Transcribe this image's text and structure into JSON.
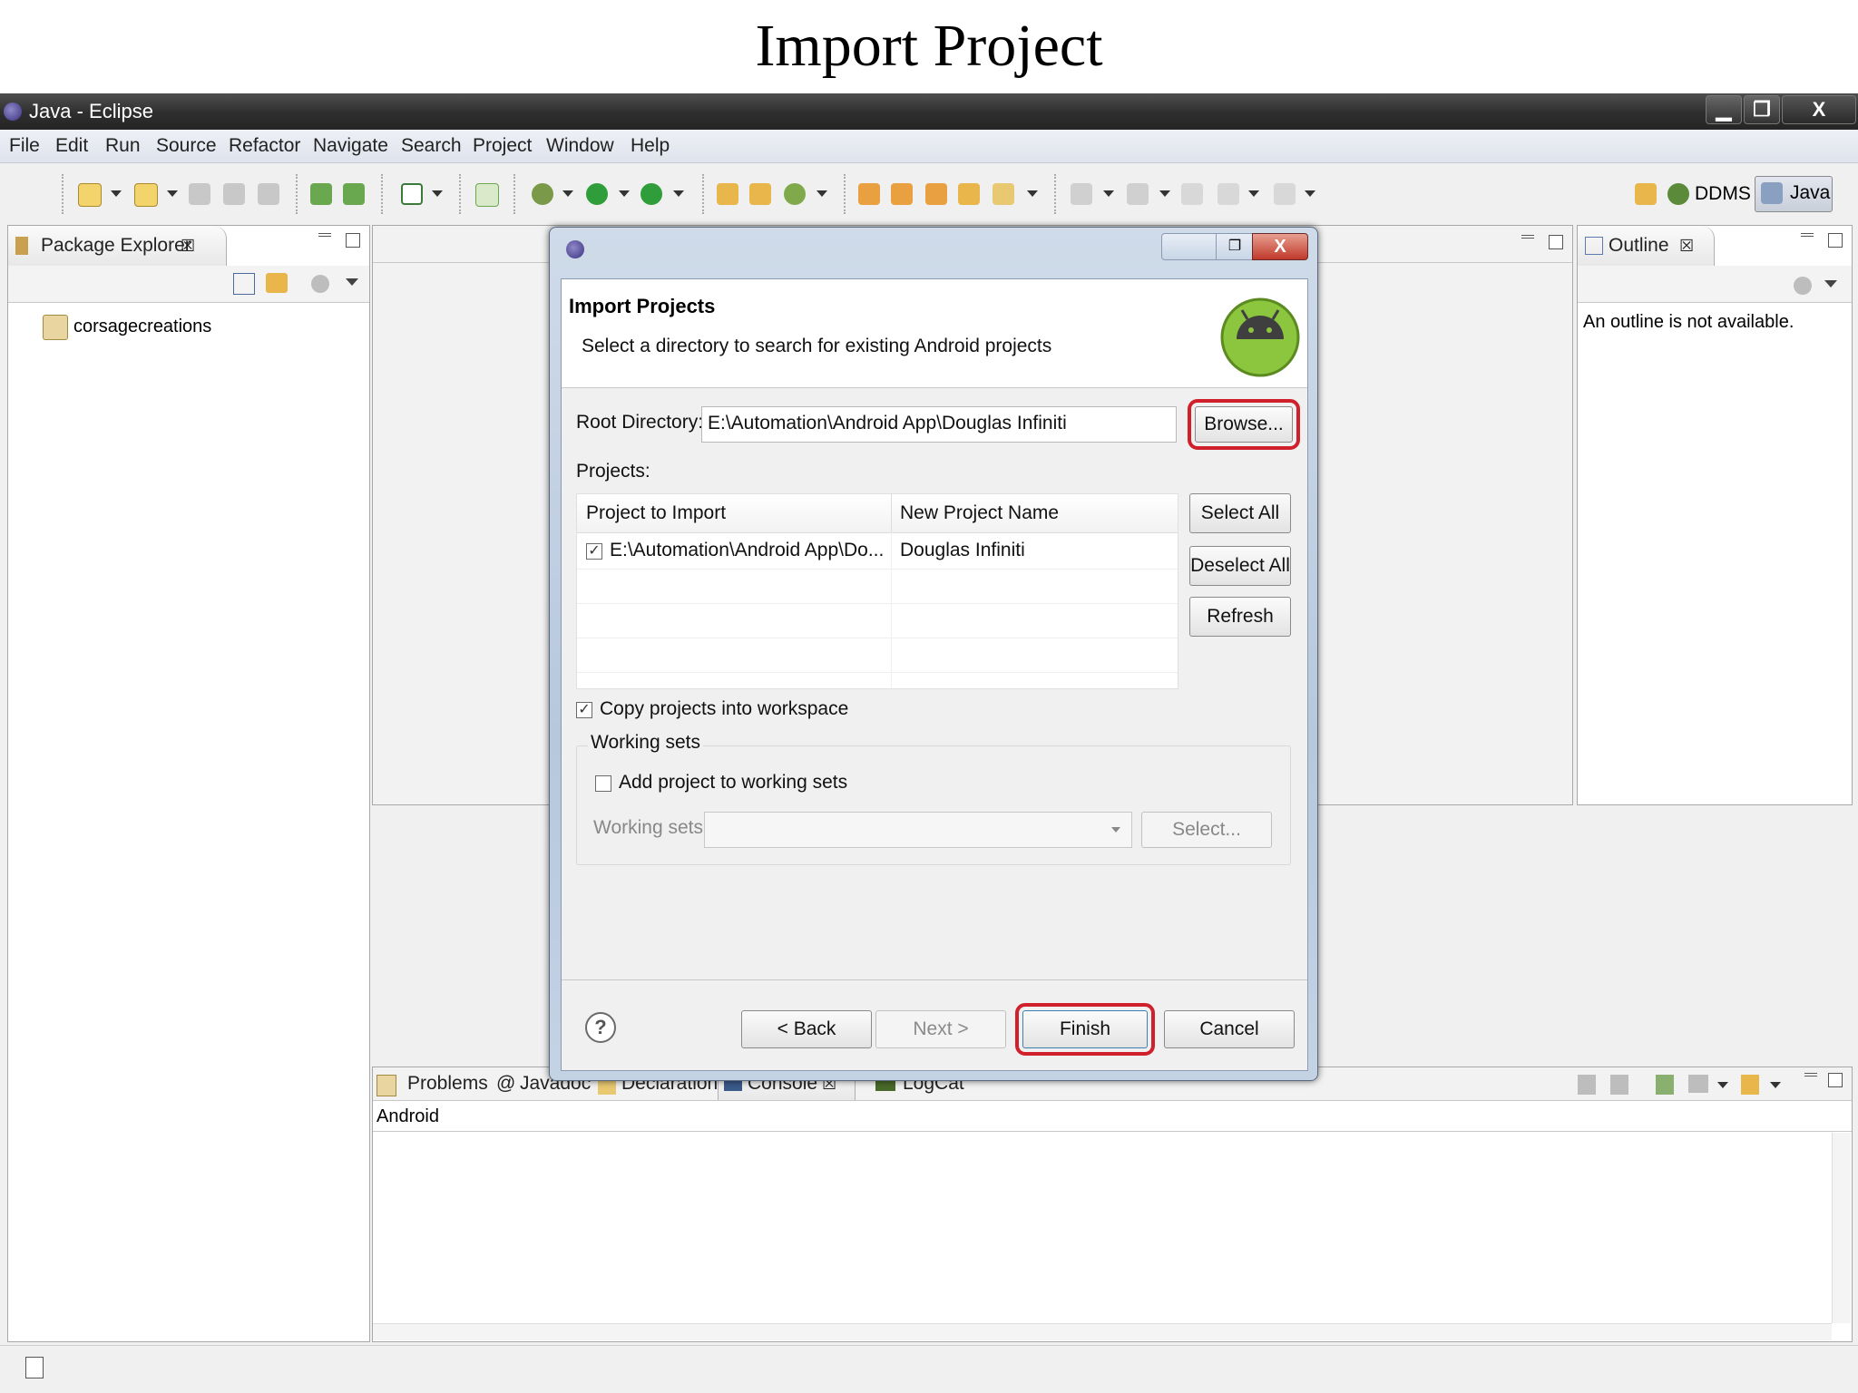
{
  "slide": {
    "title": "Import Project"
  },
  "window": {
    "title": "Java - Eclipse",
    "controls": {
      "minimize": "▁",
      "restore": "❐",
      "close": "X"
    }
  },
  "menu": [
    "File",
    "Edit",
    "Run",
    "Source",
    "Refactor",
    "Navigate",
    "Search",
    "Project",
    "Window",
    "Help"
  ],
  "perspectives": {
    "ddms": "DDMS",
    "java": "Java"
  },
  "package_explorer": {
    "tab_label": "Package Explorer",
    "close_glyph": "☒",
    "items": [
      {
        "label": "corsagecreations",
        "icon": "project-icon"
      }
    ]
  },
  "outline": {
    "tab_label": "Outline",
    "close_glyph": "☒",
    "message": "An outline is not available."
  },
  "bottom_panel": {
    "tabs": [
      "Problems",
      "Javadoc",
      "Declaration",
      "Console",
      "LogCat"
    ],
    "active_tab": "Console",
    "console_label": "Android",
    "at_glyph": "@"
  },
  "dialog": {
    "header_title": "Import Projects",
    "header_subtitle": "Select a directory to search for existing Android projects",
    "root_directory_label": "Root Directory:",
    "root_directory_value": "E:\\Automation\\Android App\\Douglas Infiniti",
    "browse_button": "Browse...",
    "projects_label": "Projects:",
    "table": {
      "columns": [
        "Project to Import",
        "New Project Name"
      ],
      "rows": [
        {
          "checked": true,
          "project": "E:\\Automation\\Android App\\Do...",
          "name": "Douglas Infiniti"
        }
      ]
    },
    "select_all_button": "Select All",
    "deselect_all_button": "Deselect All",
    "refresh_button": "Refresh",
    "copy_projects": {
      "label": "Copy projects into workspace",
      "checked": true
    },
    "working_sets_group": "Working sets",
    "add_to_working_sets": {
      "label": "Add project to working sets",
      "checked": false
    },
    "working_sets_label": "Working sets:",
    "working_sets_value": "",
    "select_button": "Select...",
    "help_glyph": "?",
    "back_button": "< Back",
    "next_button": "Next >",
    "finish_button": "Finish",
    "cancel_button": "Cancel",
    "check_glyph": "✓"
  },
  "colors": {
    "highlight": "#d0202c",
    "title_bar": "#2e2e2e",
    "android_green": "#8cc63f"
  }
}
